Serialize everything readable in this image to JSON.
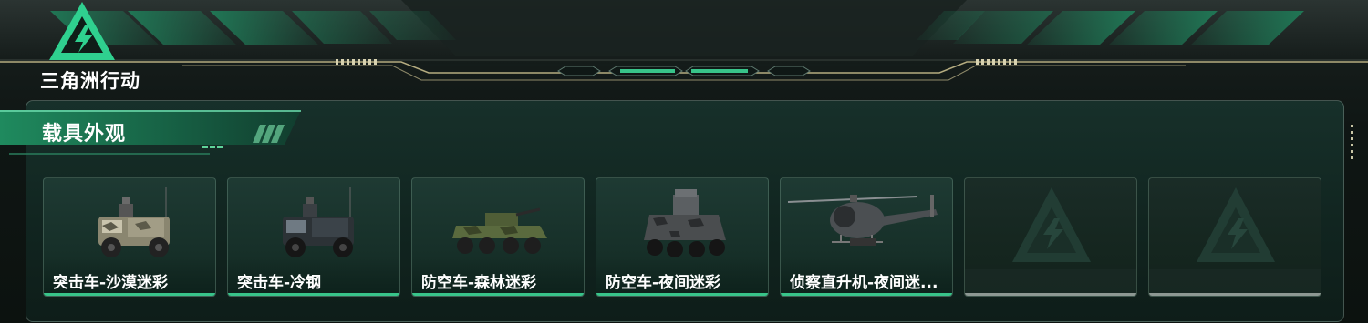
{
  "header": {
    "game_title": "三角洲行动"
  },
  "section": {
    "title": "载具外观"
  },
  "skins": [
    {
      "label": "突击车-沙漠迷彩",
      "vehicle": "armored-truck-desert-icon",
      "equipped": true
    },
    {
      "label": "突击车-冷钢",
      "vehicle": "armored-truck-steel-icon",
      "equipped": true
    },
    {
      "label": "防空车-森林迷彩",
      "vehicle": "apc-forest-icon",
      "equipped": true
    },
    {
      "label": "防空车-夜间迷彩",
      "vehicle": "apc-night-icon",
      "equipped": true
    },
    {
      "label": "侦察直升机-夜间迷...",
      "vehicle": "helicopter-night-icon",
      "equipped": true
    },
    {
      "label": "",
      "vehicle": "empty-slot-logo-icon",
      "equipped": false
    },
    {
      "label": "",
      "vehicle": "empty-slot-logo-icon",
      "equipped": false
    }
  ],
  "colors": {
    "accent_green": "#38c48a",
    "empty_underline": "#8d9893",
    "background": "#101614"
  }
}
